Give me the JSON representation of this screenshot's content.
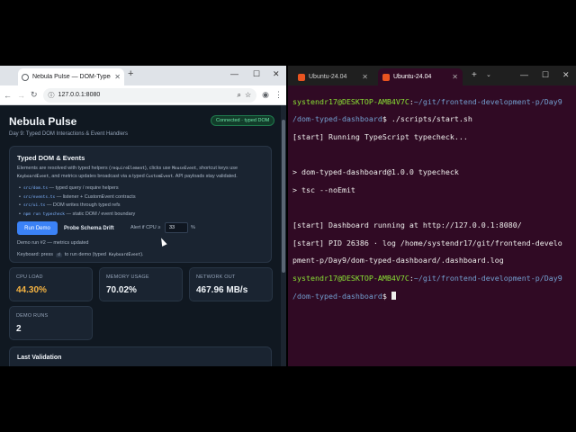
{
  "browser": {
    "tab_title": "Nebula Pulse — DOM-Typed D",
    "url": "127.0.0.1:8080"
  },
  "page": {
    "title": "Nebula Pulse",
    "subtitle": "Day 9: Typed DOM Interactions & Event Handlers",
    "badge": "Connected · typed DOM",
    "card": {
      "title": "Typed DOM & Events",
      "desc_1": "Elements are resolved with typed helpers (",
      "desc_code_1": "requireElement",
      "desc_2": "), clicks use ",
      "desc_code_2": "MouseEvent",
      "desc_3": ", shortcut keys use ",
      "desc_code_3": "KeyboardEvent",
      "desc_4": ", and metrics updates broadcast via a typed ",
      "desc_code_4": "CustomEvent",
      "desc_5": ". API payloads stay validated.",
      "bullets": [
        {
          "code": "src/dom.ts",
          "text": " — typed query / require helpers"
        },
        {
          "code": "src/events.ts",
          "text": " — listener + CustomEvent contracts"
        },
        {
          "code": "src/ui.ts",
          "text": " — DOM writes through typed refs"
        },
        {
          "code": "npm run typecheck",
          "text": " — static DOM / event boundary"
        }
      ],
      "run_button": "Run Demo",
      "probe_button": "Probe Schema Drift",
      "alert_label": "Alert if CPU ≥",
      "alert_value": "33",
      "alert_unit": "%",
      "status": "Demo run #2 — metrics updated",
      "kb_prefix": "Keyboard: press",
      "kb_key": "d",
      "kb_mid": "to run demo (typed",
      "kb_code": "KeyboardEvent",
      "kb_end": ")."
    },
    "metrics": {
      "cpu": {
        "label": "CPU LOAD",
        "value": "44.30%",
        "color": "#f5b342"
      },
      "memory": {
        "label": "MEMORY USAGE",
        "value": "70.02%"
      },
      "network": {
        "label": "NETWORK OUT",
        "value": "467.96 MB/s"
      },
      "runs": {
        "label": "DEMO RUNS",
        "value": "2"
      }
    },
    "last_validation": {
      "title": "Last Validation"
    }
  },
  "terminal": {
    "tabs": [
      "Ubuntu-24.04",
      "Ubuntu-24.04"
    ],
    "prompt_user": "systendr17@DESKTOP-AMB4V7C",
    "prompt_path": "~/git/frontend-development-p/Day9/dom-typed-dashboard",
    "lines": {
      "l1_cmd": "./scripts/start.sh",
      "l2": "[start] Running TypeScript typecheck...",
      "l3": "",
      "l4": "> dom-typed-dashboard@1.0.0 typecheck",
      "l5": "> tsc --noEmit",
      "l6": "",
      "l7": "[start] Dashboard running at http://127.0.0.1:8080/",
      "l8": "[start] PID 26386 · log /home/systendr17/git/frontend-develo",
      "l9": "pment-p/Day9/dom-typed-dashboard/.dashboard.log"
    },
    "accent": "#e95420"
  }
}
